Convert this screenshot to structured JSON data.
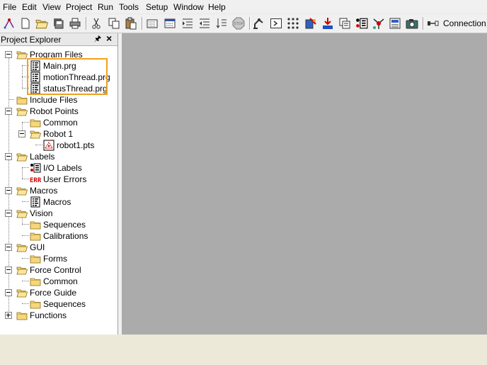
{
  "menu": [
    "File",
    "Edit",
    "View",
    "Project",
    "Run",
    "Tools",
    "Setup",
    "Window",
    "Help"
  ],
  "toolbar": {
    "connection_label": "Connection:",
    "buttons": [
      "new-project-icon",
      "new-file-icon",
      "open-icon",
      "save-all-icon",
      "print-icon",
      "cut-icon",
      "copy-icon",
      "paste-icon",
      "build-icon",
      "run-window-icon",
      "indent-icon",
      "outdent-icon",
      "line-number-icon",
      "stop-icon",
      "robot-manager-icon",
      "command-window-icon",
      "points-icon",
      "io-monitor-icon",
      "download-icon",
      "task-manager-icon",
      "io-label-icon",
      "hardware-icon",
      "system-history-icon",
      "camera-icon",
      "connection-icon"
    ]
  },
  "explorer": {
    "title": "Project Explorer",
    "nodes": {
      "program_files": "Program Files",
      "main_prg": "Main.prg",
      "motion_thread": "motionThread.prg",
      "status_thread": "statusThread.prg",
      "include_files": "Include Files",
      "robot_points": "Robot Points",
      "common1": "Common",
      "robot1": "Robot 1",
      "robot1_pts": "robot1.pts",
      "labels": "Labels",
      "io_labels": "I/O Labels",
      "user_errors": "User Errors",
      "macros": "Macros",
      "macros_child": "Macros",
      "vision": "Vision",
      "sequences1": "Sequences",
      "calibrations": "Calibrations",
      "gui": "GUI",
      "forms": "Forms",
      "force_control": "Force Control",
      "common2": "Common",
      "force_guide": "Force Guide",
      "sequences2": "Sequences",
      "functions": "Functions"
    }
  },
  "colors": {
    "highlight": "#f0a020",
    "workspace": "#ababab",
    "folder": "#f5d77a"
  }
}
